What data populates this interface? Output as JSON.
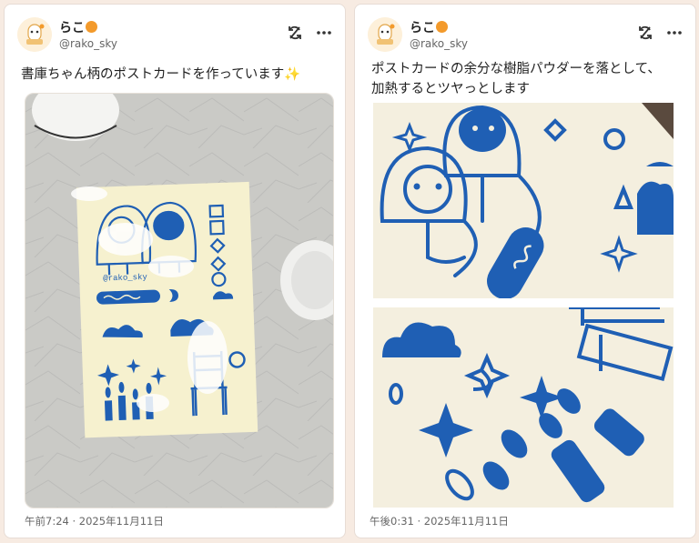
{
  "posts": [
    {
      "author": {
        "name": "らこ",
        "handle": "@rako_sky",
        "name_icon": "orange-emoji"
      },
      "text": "書庫ちゃん柄のポストカードを作っています✨",
      "timestamp": "午前7:24 · 2025年11月11日",
      "media": {
        "type": "photo",
        "subject": "postcard-with-powder",
        "card_print": "@rako_sky"
      }
    },
    {
      "author": {
        "name": "らこ",
        "handle": "@rako_sky",
        "name_icon": "orange-emoji"
      },
      "text_lines": [
        "ポストカードの余分な樹脂パウダーを落として、",
        "加熱するとツヤっとします"
      ],
      "timestamp": "午後0:31 · 2025年11月11日",
      "media": [
        {
          "type": "photo",
          "subject": "embossed-characters-closeup"
        },
        {
          "type": "photo",
          "subject": "embossed-candles-closeup"
        }
      ]
    }
  ],
  "icons": {
    "sync": "sync-slash-icon",
    "more": "more-horizontal-icon"
  },
  "colors": {
    "ink_blue": "#1f5fb4",
    "card_cream": "#f6f1cf",
    "orange": "#f39a2b"
  }
}
